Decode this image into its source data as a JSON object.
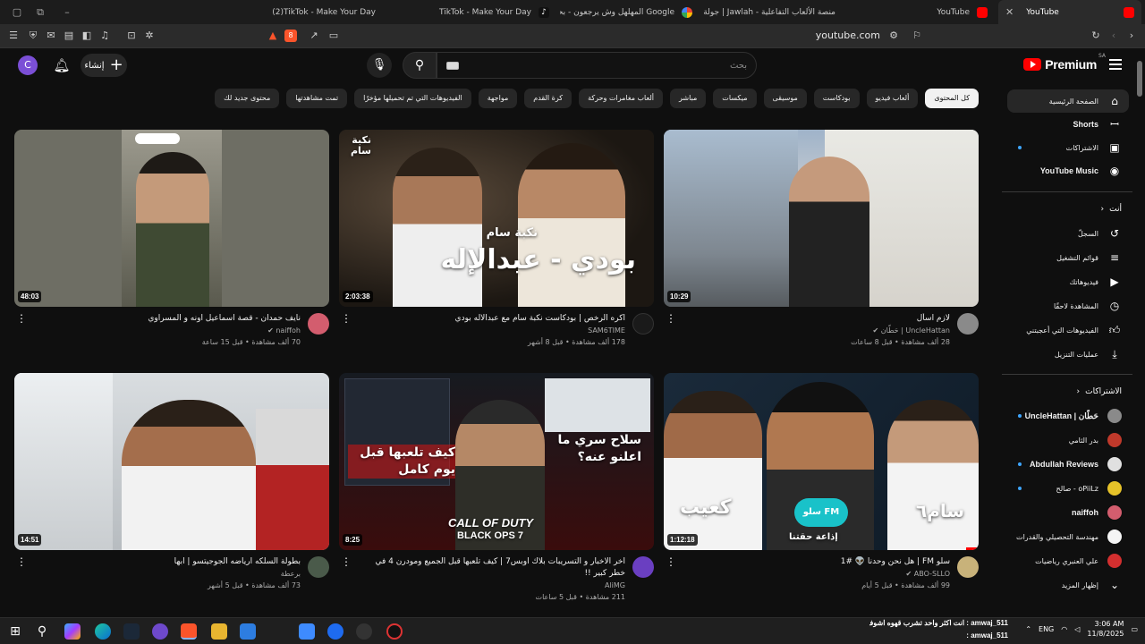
{
  "browser": {
    "tabs": [
      {
        "label": "(2)TikTok - Make Your Day",
        "icon": "tiktok-icon",
        "active": false
      },
      {
        "label": "TikTok - Make Your Day",
        "icon": "tiktok-icon",
        "active": false
      },
      {
        "label": "المهلهل وش يرجعون - بحث Google",
        "icon": "google-icon",
        "active": false
      },
      {
        "label": "جولة | Jawlah - منصة الألعاب التفاعلية",
        "icon": "jawlah-icon",
        "active": false
      },
      {
        "label": "YouTube",
        "icon": "youtube-icon",
        "active": false
      },
      {
        "label": "YouTube",
        "icon": "youtube-icon",
        "active": true
      }
    ],
    "url": "youtube.com",
    "brave_badge": "8"
  },
  "masthead": {
    "account_initial": "C",
    "create_label": "إنشاء",
    "search_placeholder": "بحث",
    "logo_text": "Premium",
    "region": "SA"
  },
  "chips": [
    {
      "label": "كل المحتوى",
      "selected": true
    },
    {
      "label": "ألعاب فيديو"
    },
    {
      "label": "بودكاست"
    },
    {
      "label": "موسيقى"
    },
    {
      "label": "ميكسات"
    },
    {
      "label": "مباشر"
    },
    {
      "label": "ألعاب مغامرات وحركة"
    },
    {
      "label": "كرة القدم"
    },
    {
      "label": "مواجهة"
    },
    {
      "label": "الفيديوهات التي تم تحميلها مؤخرًا"
    },
    {
      "label": "تمت مشاهدتها"
    },
    {
      "label": "محتوى جديد لك"
    }
  ],
  "sidebar": {
    "main": [
      {
        "label": "الصفحة الرئيسية",
        "icon": "home-icon",
        "active": true
      },
      {
        "label": "Shorts",
        "icon": "shorts-icon"
      },
      {
        "label": "الاشتراكات",
        "icon": "subscriptions-icon",
        "dot": true
      },
      {
        "label": "YouTube Music",
        "icon": "youtube-music-icon"
      }
    ],
    "you_heading": "أنت",
    "you": [
      {
        "label": "السجلّ",
        "icon": "history-icon"
      },
      {
        "label": "قوائم التشغيل",
        "icon": "playlists-icon"
      },
      {
        "label": "فيديوهاتك",
        "icon": "your-videos-icon"
      },
      {
        "label": "المشاهدة لاحقًا",
        "icon": "watch-later-icon"
      },
      {
        "label": "الفيديوهات التي أعجبتني",
        "icon": "liked-icon"
      },
      {
        "label": "عمليات التنزيل",
        "icon": "download-icon"
      }
    ],
    "subs_heading": "الاشتراكات",
    "subscriptions": [
      {
        "label": "UncleHattan | حَطّان",
        "color": "#8a8a8a",
        "dot": true
      },
      {
        "label": "بدر الثامي",
        "color": "#c0392b"
      },
      {
        "label": "Abdullah Reviews",
        "color": "#e0e0e0",
        "dot": true
      },
      {
        "label": "صالح - oPiiLz",
        "color": "#e6c229",
        "dot": true
      },
      {
        "label": "naiffoh",
        "color": "#d35d6e"
      },
      {
        "label": "مهندسة التحصيلي والقدرات",
        "color": "#f5f5f5"
      },
      {
        "label": "علي العنبري رياضيات",
        "color": "#d32f2f"
      }
    ],
    "show_more": "إظهار المزيد"
  },
  "videos": [
    {
      "title": "لازم اسأل",
      "channel": "UncleHattan | حَطّان",
      "stats": "28 ألف مشاهدة • قبل 8 ساعات",
      "duration": "10:29",
      "avatar_color": "#8a8a8a",
      "verified": true
    },
    {
      "title": "اكره الرخص | بودكاست نكبة سام مع عبدالاله بودي",
      "channel": "SAM6TIME",
      "stats": "178 ألف مشاهدة • قبل 8 أشهر",
      "duration": "2:03:38",
      "avatar_color": "#1a1a1a",
      "overlay_main": "بودي - عبدالإله",
      "overlay_sub": "نكبة سام",
      "overlay_corner": "نكبة سام"
    },
    {
      "title": "نايف حمدان - قصة اسماعيل اونه و المسراوي",
      "channel": "naiffoh",
      "stats": "70 ألف مشاهدة • قبل 15 ساعة",
      "duration": "48:03",
      "avatar_color": "#d35d6e",
      "verified": true
    },
    {
      "title": "سلو FM | هل نحن وحدنا 👽 #1",
      "channel": "ABO-SLLO",
      "stats": "99 ألف مشاهدة • قبل 5 أيام",
      "duration": "1:12:18",
      "avatar_color": "#c8b27a",
      "verified": true,
      "overlay_left": "كعيب",
      "overlay_right": "سام٦",
      "overlay_badge": "سلو FM",
      "overlay_caption": "إذاعة حقتنا"
    },
    {
      "title": "اخر الاخبار و التسريبات بلاك اوبس7 | كيف تلعبها قبل الجميع ومودرن 4 في خطر كبير !!",
      "channel": "AliMG",
      "stats": "211 مشاهدة • قبل 5 ساعات",
      "duration": "8:25",
      "avatar_color": "#6a3fc1",
      "overlay_a": "سلاح سري ما اعلنو عنه؟",
      "overlay_b": "كيف تلعبها قبل يوم كامل",
      "overlay_game1": "CALL OF DUTY",
      "overlay_game2": "BLACK OPS 7"
    },
    {
      "title": "بطولة السلكه ارياضه الجوجيتسو | ابها",
      "channel": "برعطة",
      "stats": "73 ألف مشاهدة • قبل 5 أشهر",
      "duration": "14:51",
      "avatar_color": "#4a5a4a"
    }
  ],
  "taskbar": {
    "chat": [
      {
        "user": "amwaj_511",
        "msg": "انت اكثر واحد تشرب قهوه اشوفك انستا"
      },
      {
        "user": "amwaj_511",
        "msg": ""
      }
    ],
    "lang": "ENG",
    "time": "3:06 AM",
    "date": "11/8/2025"
  }
}
